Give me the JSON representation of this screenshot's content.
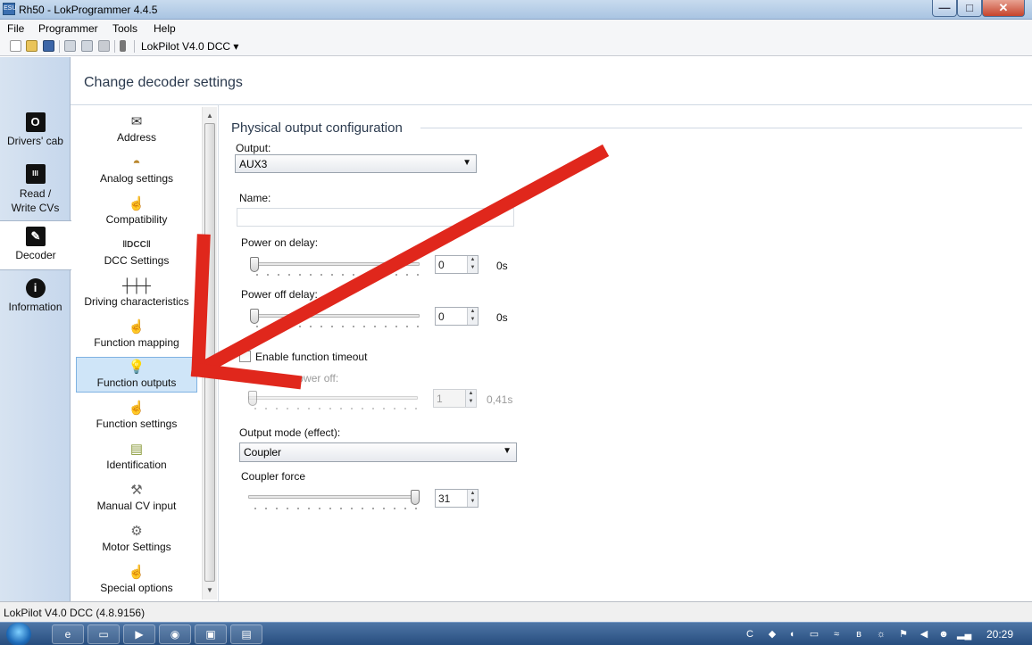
{
  "window": {
    "title": "Rh50 - LokProgrammer 4.4.5",
    "minimize": "—",
    "maximize": "□",
    "close": "✕"
  },
  "menu": [
    "File",
    "Programmer",
    "Tools",
    "Help"
  ],
  "toolbar": {
    "device": "LokPilot V4.0 DCC ▾",
    "icons": [
      "new-icon",
      "open-icon",
      "save-icon",
      "export-icon",
      "import-icon",
      "play-icon",
      "info-icon"
    ]
  },
  "nav": [
    {
      "label": "Drivers' cab",
      "icon": "cab-icon"
    },
    {
      "label": "Read /\nWrite CVs",
      "icon": "read-write-icon"
    },
    {
      "label": "Decoder",
      "icon": "wrench-icon",
      "selected": true
    },
    {
      "label": "Information",
      "icon": "info-icon"
    }
  ],
  "header": {
    "title": "Change decoder settings"
  },
  "categories": [
    {
      "label": "Address",
      "icon": "envelope-icon"
    },
    {
      "label": "Analog settings",
      "icon": "gauge-icon"
    },
    {
      "label": "Compatibility",
      "icon": "hand-pointer-icon"
    },
    {
      "label": "DCC Settings",
      "icon": "dcc-icon"
    },
    {
      "label": "Driving characteristics",
      "icon": "sliders-icon"
    },
    {
      "label": "Function mapping",
      "icon": "hand-pointer-icon"
    },
    {
      "label": "Function outputs",
      "icon": "lightbulb-icon",
      "selected": true
    },
    {
      "label": "Function settings",
      "icon": "hand-pointer-icon"
    },
    {
      "label": "Identification",
      "icon": "id-card-icon"
    },
    {
      "label": "Manual CV input",
      "icon": "tool-icon"
    },
    {
      "label": "Motor Settings",
      "icon": "motor-icon"
    },
    {
      "label": "Special options",
      "icon": "hand-pointer-icon"
    }
  ],
  "config": {
    "section_title": "Physical output configuration",
    "output_label": "Output:",
    "output_value": "AUX3",
    "name_label": "Name:",
    "name_value": "",
    "power_on_delay_label": "Power on delay:",
    "power_on_delay_value": "0",
    "power_on_delay_unit": "0s",
    "power_on_delay_level": 0,
    "power_off_delay_label": "Power off delay:",
    "power_off_delay_value": "0",
    "power_off_delay_unit": "0s",
    "power_off_delay_level": 0,
    "enable_timeout_label": "Enable function timeout",
    "enable_timeout_checked": false,
    "auto_power_off_label": "Automatic power off:",
    "auto_power_off_value": "1",
    "auto_power_off_unit": "0,41s",
    "output_mode_label": "Output mode (effect):",
    "output_mode_value": "Coupler",
    "coupler_force_label": "Coupler force",
    "coupler_force_value": "31",
    "coupler_force_level": 1.0
  },
  "status": {
    "text": "LokPilot V4.0 DCC (4.8.9156)"
  },
  "taskbar": {
    "clock": "20:29"
  },
  "colors": {
    "annotation_arrow": "#e0271c",
    "selection": "#cfe5f8",
    "nav_bg": "#d7e3f1"
  }
}
